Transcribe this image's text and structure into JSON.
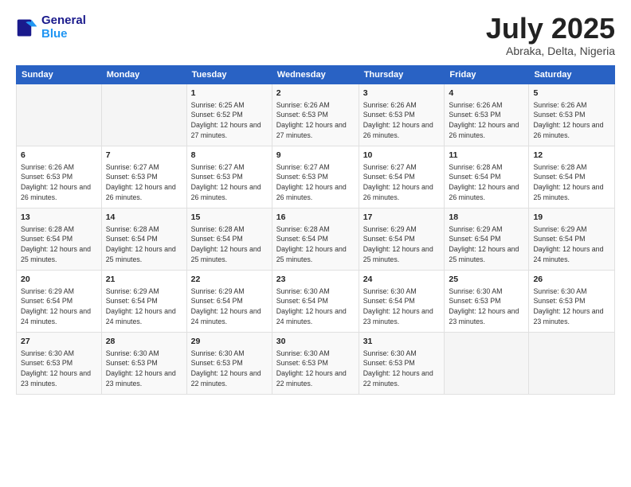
{
  "logo": {
    "line1": "General",
    "line2": "Blue"
  },
  "title": "July 2025",
  "location": "Abraka, Delta, Nigeria",
  "days_of_week": [
    "Sunday",
    "Monday",
    "Tuesday",
    "Wednesday",
    "Thursday",
    "Friday",
    "Saturday"
  ],
  "weeks": [
    [
      {
        "day": "",
        "info": ""
      },
      {
        "day": "",
        "info": ""
      },
      {
        "day": "1",
        "info": "Sunrise: 6:25 AM\nSunset: 6:52 PM\nDaylight: 12 hours and 27 minutes."
      },
      {
        "day": "2",
        "info": "Sunrise: 6:26 AM\nSunset: 6:53 PM\nDaylight: 12 hours and 27 minutes."
      },
      {
        "day": "3",
        "info": "Sunrise: 6:26 AM\nSunset: 6:53 PM\nDaylight: 12 hours and 26 minutes."
      },
      {
        "day": "4",
        "info": "Sunrise: 6:26 AM\nSunset: 6:53 PM\nDaylight: 12 hours and 26 minutes."
      },
      {
        "day": "5",
        "info": "Sunrise: 6:26 AM\nSunset: 6:53 PM\nDaylight: 12 hours and 26 minutes."
      }
    ],
    [
      {
        "day": "6",
        "info": "Sunrise: 6:26 AM\nSunset: 6:53 PM\nDaylight: 12 hours and 26 minutes."
      },
      {
        "day": "7",
        "info": "Sunrise: 6:27 AM\nSunset: 6:53 PM\nDaylight: 12 hours and 26 minutes."
      },
      {
        "day": "8",
        "info": "Sunrise: 6:27 AM\nSunset: 6:53 PM\nDaylight: 12 hours and 26 minutes."
      },
      {
        "day": "9",
        "info": "Sunrise: 6:27 AM\nSunset: 6:53 PM\nDaylight: 12 hours and 26 minutes."
      },
      {
        "day": "10",
        "info": "Sunrise: 6:27 AM\nSunset: 6:54 PM\nDaylight: 12 hours and 26 minutes."
      },
      {
        "day": "11",
        "info": "Sunrise: 6:28 AM\nSunset: 6:54 PM\nDaylight: 12 hours and 26 minutes."
      },
      {
        "day": "12",
        "info": "Sunrise: 6:28 AM\nSunset: 6:54 PM\nDaylight: 12 hours and 25 minutes."
      }
    ],
    [
      {
        "day": "13",
        "info": "Sunrise: 6:28 AM\nSunset: 6:54 PM\nDaylight: 12 hours and 25 minutes."
      },
      {
        "day": "14",
        "info": "Sunrise: 6:28 AM\nSunset: 6:54 PM\nDaylight: 12 hours and 25 minutes."
      },
      {
        "day": "15",
        "info": "Sunrise: 6:28 AM\nSunset: 6:54 PM\nDaylight: 12 hours and 25 minutes."
      },
      {
        "day": "16",
        "info": "Sunrise: 6:28 AM\nSunset: 6:54 PM\nDaylight: 12 hours and 25 minutes."
      },
      {
        "day": "17",
        "info": "Sunrise: 6:29 AM\nSunset: 6:54 PM\nDaylight: 12 hours and 25 minutes."
      },
      {
        "day": "18",
        "info": "Sunrise: 6:29 AM\nSunset: 6:54 PM\nDaylight: 12 hours and 25 minutes."
      },
      {
        "day": "19",
        "info": "Sunrise: 6:29 AM\nSunset: 6:54 PM\nDaylight: 12 hours and 24 minutes."
      }
    ],
    [
      {
        "day": "20",
        "info": "Sunrise: 6:29 AM\nSunset: 6:54 PM\nDaylight: 12 hours and 24 minutes."
      },
      {
        "day": "21",
        "info": "Sunrise: 6:29 AM\nSunset: 6:54 PM\nDaylight: 12 hours and 24 minutes."
      },
      {
        "day": "22",
        "info": "Sunrise: 6:29 AM\nSunset: 6:54 PM\nDaylight: 12 hours and 24 minutes."
      },
      {
        "day": "23",
        "info": "Sunrise: 6:30 AM\nSunset: 6:54 PM\nDaylight: 12 hours and 24 minutes."
      },
      {
        "day": "24",
        "info": "Sunrise: 6:30 AM\nSunset: 6:54 PM\nDaylight: 12 hours and 23 minutes."
      },
      {
        "day": "25",
        "info": "Sunrise: 6:30 AM\nSunset: 6:53 PM\nDaylight: 12 hours and 23 minutes."
      },
      {
        "day": "26",
        "info": "Sunrise: 6:30 AM\nSunset: 6:53 PM\nDaylight: 12 hours and 23 minutes."
      }
    ],
    [
      {
        "day": "27",
        "info": "Sunrise: 6:30 AM\nSunset: 6:53 PM\nDaylight: 12 hours and 23 minutes."
      },
      {
        "day": "28",
        "info": "Sunrise: 6:30 AM\nSunset: 6:53 PM\nDaylight: 12 hours and 23 minutes."
      },
      {
        "day": "29",
        "info": "Sunrise: 6:30 AM\nSunset: 6:53 PM\nDaylight: 12 hours and 22 minutes."
      },
      {
        "day": "30",
        "info": "Sunrise: 6:30 AM\nSunset: 6:53 PM\nDaylight: 12 hours and 22 minutes."
      },
      {
        "day": "31",
        "info": "Sunrise: 6:30 AM\nSunset: 6:53 PM\nDaylight: 12 hours and 22 minutes."
      },
      {
        "day": "",
        "info": ""
      },
      {
        "day": "",
        "info": ""
      }
    ]
  ]
}
